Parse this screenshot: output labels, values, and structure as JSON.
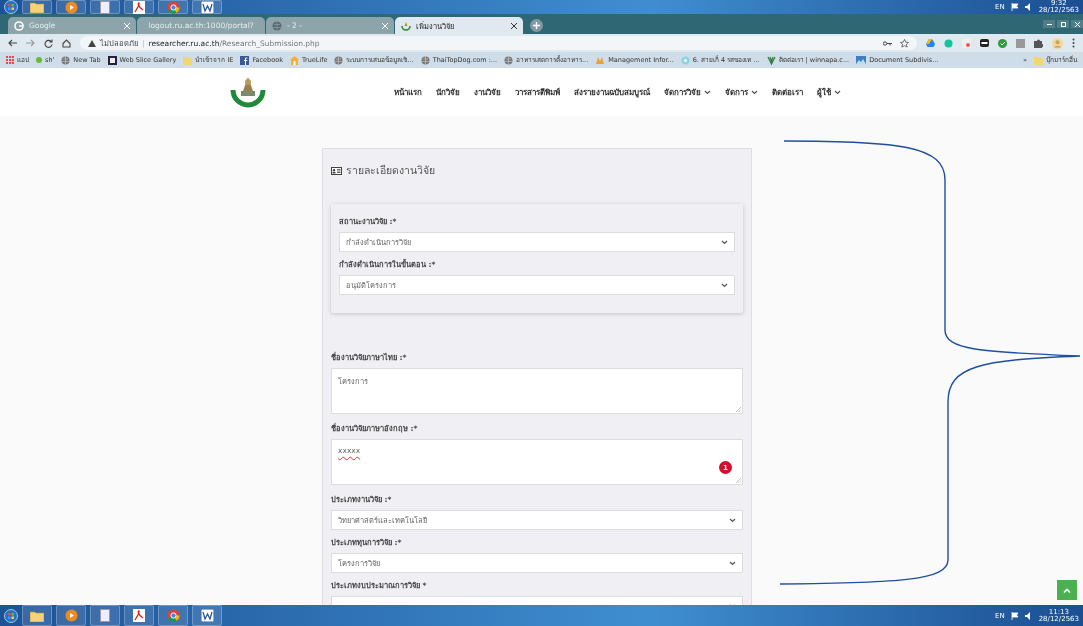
{
  "top_taskbar": {
    "apps": [
      {
        "kind": "start"
      },
      {
        "kind": "folder"
      },
      {
        "kind": "media"
      },
      {
        "kind": "doc"
      },
      {
        "kind": "pdf"
      },
      {
        "kind": "browser"
      },
      {
        "kind": "word"
      }
    ],
    "language": "EN",
    "time": "9:32",
    "date": "28/12/2563"
  },
  "tabs": [
    {
      "title": "Google",
      "kind": "g",
      "selected": false
    },
    {
      "title": "logout.ru.ac.th:1000/portal?",
      "kind": "globe",
      "selected": false
    },
    {
      "title": "- 2 -",
      "kind": "globe",
      "selected": false
    },
    {
      "title": "เพิ่มงานวิจัย",
      "kind": "emblem",
      "selected": true
    }
  ],
  "address_bar": {
    "security": "ไม่ปลอดภัย",
    "separator": "|",
    "host": "researcher.ru.ac.th",
    "path": "/Research_Submission.php"
  },
  "bookmarks": [
    {
      "label": "แอป",
      "kind": "apps"
    },
    {
      "label": "sh'",
      "kind": "dot"
    },
    {
      "label": "New Tab",
      "kind": "globe"
    },
    {
      "label": "Web Slice Gallery",
      "kind": "tile"
    },
    {
      "label": "นำเข้าจาก IE",
      "kind": "folder"
    },
    {
      "label": "Facebook",
      "kind": "fb"
    },
    {
      "label": "TrueLife",
      "kind": "house"
    },
    {
      "label": "ระบบการเสนอข้อมูลเชิ...",
      "kind": "globe"
    },
    {
      "label": "ThaiTopDog.com :...",
      "kind": "globe"
    },
    {
      "label": "อาหารเสดการตั้งอาหาร...",
      "kind": "globe"
    },
    {
      "label": "Management Infor...",
      "kind": "hand"
    },
    {
      "label": "6. สายเก็ 4 รสของเท ...",
      "kind": "flower"
    },
    {
      "label": "ติดต่อเรา | winnapa.c...",
      "kind": "leaf"
    },
    {
      "label": "Document Subdivis...",
      "kind": "image"
    }
  ],
  "bookmarks_more": "»",
  "other_bookmarks": "บุ๊กมาร์กอื่น",
  "nav": [
    {
      "label": "หน้าแรก",
      "dropdown": false
    },
    {
      "label": "นักวิจัย",
      "dropdown": false
    },
    {
      "label": "งานวิจัย",
      "dropdown": false
    },
    {
      "label": "วารสารตีพิมพ์",
      "dropdown": false
    },
    {
      "label": "ส่งรายงานฉบับสมบูรณ์",
      "dropdown": false
    },
    {
      "label": "จัดการวิจัย",
      "dropdown": true
    },
    {
      "label": "จัดการ",
      "dropdown": true
    },
    {
      "label": "ติดต่อเรา",
      "dropdown": false
    },
    {
      "label": "ผู้ใช้",
      "dropdown": true
    }
  ],
  "form": {
    "title": "รายละเอียดงานวิจัย",
    "status_panel": [
      {
        "label": "สถานะงานวิจัย :*",
        "kind": "select",
        "value": "กำลังดำเนินการวิจัย"
      },
      {
        "label": "กำลังดำเนินการในขั้นตอน :*",
        "kind": "select",
        "value": "อนุมัติโครงการ"
      }
    ],
    "fields": [
      {
        "label": "ชื่องานวิจัยภาษาไทย :*",
        "kind": "textarea",
        "value": "โครงการ"
      },
      {
        "label": "ชื่องานวิจัยภาษาอังกฤษ :*",
        "kind": "textarea",
        "value": "xxxxx",
        "spellcheck_error": true,
        "badge": "1"
      },
      {
        "label": "ประเภทงานวิจัย :*",
        "kind": "select",
        "value": "วิทยาศาสตร์และเทคโนโลยี"
      },
      {
        "label": "ประเภททุนการวิจัย :*",
        "kind": "select",
        "value": "โครงการวิจัย"
      },
      {
        "label": "ประเภทงบประมาณการวิจัย *",
        "kind": "select"
      }
    ]
  },
  "bottom_taskbar": {
    "apps": [
      {
        "kind": "start"
      },
      {
        "kind": "folder"
      },
      {
        "kind": "media"
      },
      {
        "kind": "doc"
      },
      {
        "kind": "pdf"
      },
      {
        "kind": "browser"
      },
      {
        "kind": "word"
      }
    ],
    "language": "EN",
    "time": "11:13",
    "date": "28/12/2563"
  }
}
